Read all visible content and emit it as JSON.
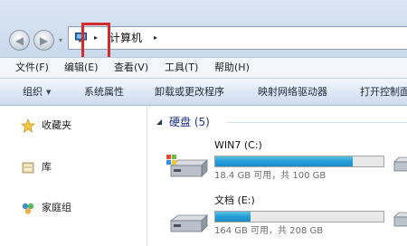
{
  "address_bar": {
    "back_glyph": "◀",
    "forward_glyph": "▶",
    "dropdown_glyph": "▾",
    "computer_icon": "computer-icon",
    "breadcrumb_arrow": "▸",
    "breadcrumb_location": "计算机",
    "highlight_color": "#d42a2a"
  },
  "menu": {
    "items": [
      "文件(F)",
      "编辑(E)",
      "查看(V)",
      "工具(T)",
      "帮助(H)"
    ]
  },
  "toolbar": {
    "organize": "组织",
    "organize_caret": "▼",
    "items": [
      "系统属性",
      "卸载或更改程序",
      "映射网络驱动器",
      "打开控制面板"
    ]
  },
  "nav_pane": {
    "items": [
      {
        "label": "收藏夹",
        "icon": "star-icon"
      },
      {
        "label": "库",
        "icon": "library-icon"
      },
      {
        "label": "家庭组",
        "icon": "homegroup-icon"
      }
    ]
  },
  "main": {
    "group_caret": "◢",
    "group_title": "硬盘 (5)",
    "drives": [
      {
        "name": "WIN7 (C:)",
        "used_fraction": 0.816,
        "size_text": "18.4 GB 可用，共 100 GB",
        "icon": "system-drive-icon"
      },
      {
        "name": "文档 (E:)",
        "used_fraction": 0.21,
        "size_text": "164 GB 可用，共 208 GB",
        "icon": "hard-drive-icon"
      }
    ]
  },
  "colors": {
    "accent_blue": "#26a0da",
    "group_title": "#1e3287",
    "toolbar_top": "#f3f7fc",
    "toolbar_bottom": "#cfdced"
  }
}
